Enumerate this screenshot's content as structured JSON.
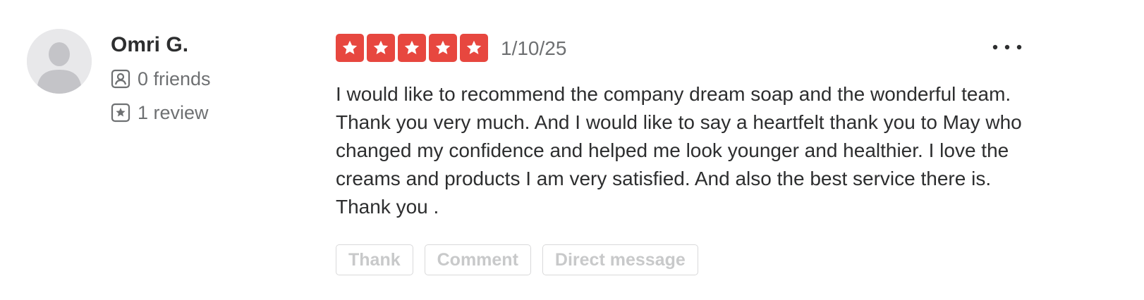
{
  "user": {
    "name": "Omri G.",
    "friends_text": "0 friends",
    "reviews_text": "1 review",
    "friends_icon": "friends-icon",
    "reviews_icon": "star-badge-icon"
  },
  "review": {
    "rating": 5,
    "rating_max": 5,
    "date": "1/10/25",
    "text": "I would like to recommend the company dream soap and the wonderful team. Thank you very much. And I would like to say a heartfelt thank you to May who changed my confidence and helped me look younger and healthier. I love the creams and products I am very satisfied. And also the best service there is. Thank you .",
    "more_icon": "more-options-icon"
  },
  "actions": {
    "thank_label": "Thank",
    "comment_label": "Comment",
    "message_label": "Direct message"
  },
  "colors": {
    "star_fill": "#e7473f",
    "text_primary": "#2d2e2f",
    "text_secondary": "#6e7072",
    "button_text_disabled": "#c8c9ca"
  }
}
